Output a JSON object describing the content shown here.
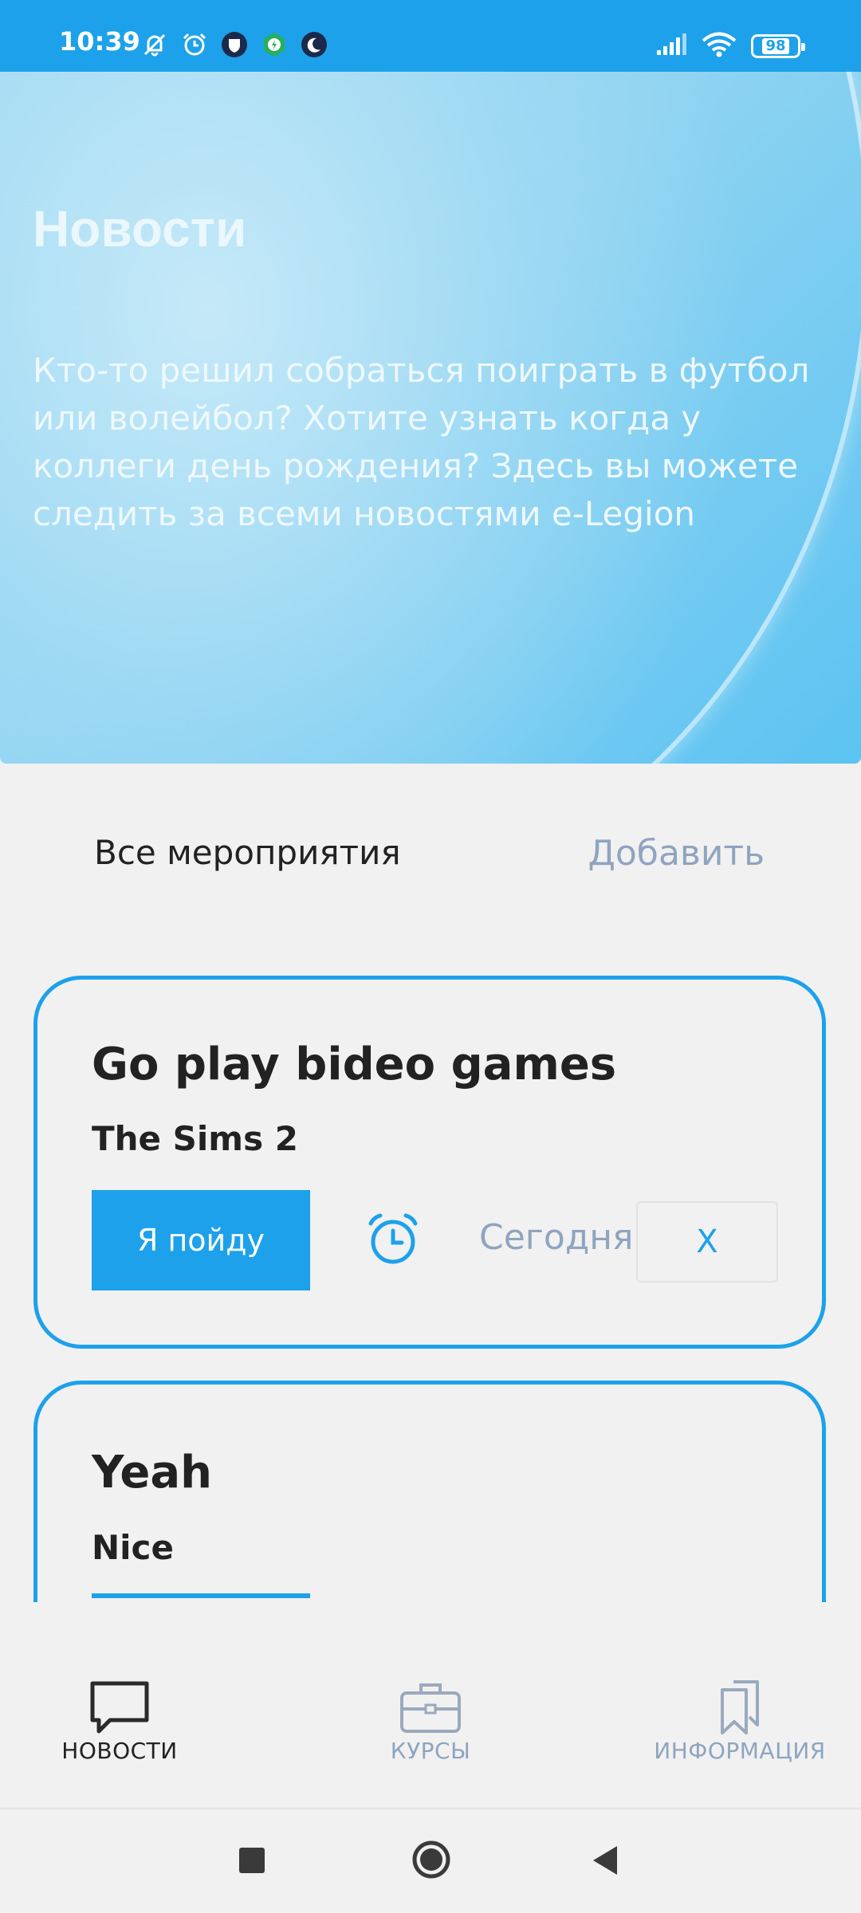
{
  "status_bar": {
    "time": "10:39",
    "battery": "98",
    "icons_left": [
      "mute-bell-icon",
      "alarm-icon",
      "app-shield-icon",
      "app-power-icon",
      "moon-icon"
    ],
    "icons_right": [
      "signal-icon",
      "wifi-icon",
      "battery-icon"
    ]
  },
  "hero": {
    "title": "Новости",
    "description": "Кто-то решил собраться поиграть в футбол или волейбол? Хотите узнать когда у коллеги день рождения? Здесь вы можете следить за всеми новостями e-Legion"
  },
  "tabs": {
    "all_label": "Все мероприятия",
    "add_label": "Добавить"
  },
  "events": [
    {
      "title": "Go play bideo games",
      "subtitle": "The Sims 2",
      "join_label": "Я пойду",
      "date_label": "Сегодня",
      "close_label": "X"
    },
    {
      "title": "Yeah",
      "subtitle": "Nice"
    }
  ],
  "bottom_nav": {
    "items": [
      {
        "label": "НОВОСТИ",
        "icon": "chat-bubble-icon",
        "active": true
      },
      {
        "label": "КУРСЫ",
        "icon": "briefcase-icon",
        "active": false
      },
      {
        "label": "ИНФОРМАЦИЯ",
        "icon": "bookmarks-icon",
        "active": false
      }
    ]
  },
  "colors": {
    "accent": "#1da1ea",
    "muted": "#8fa4bf",
    "text": "#222222",
    "background": "#f1f1f1"
  }
}
